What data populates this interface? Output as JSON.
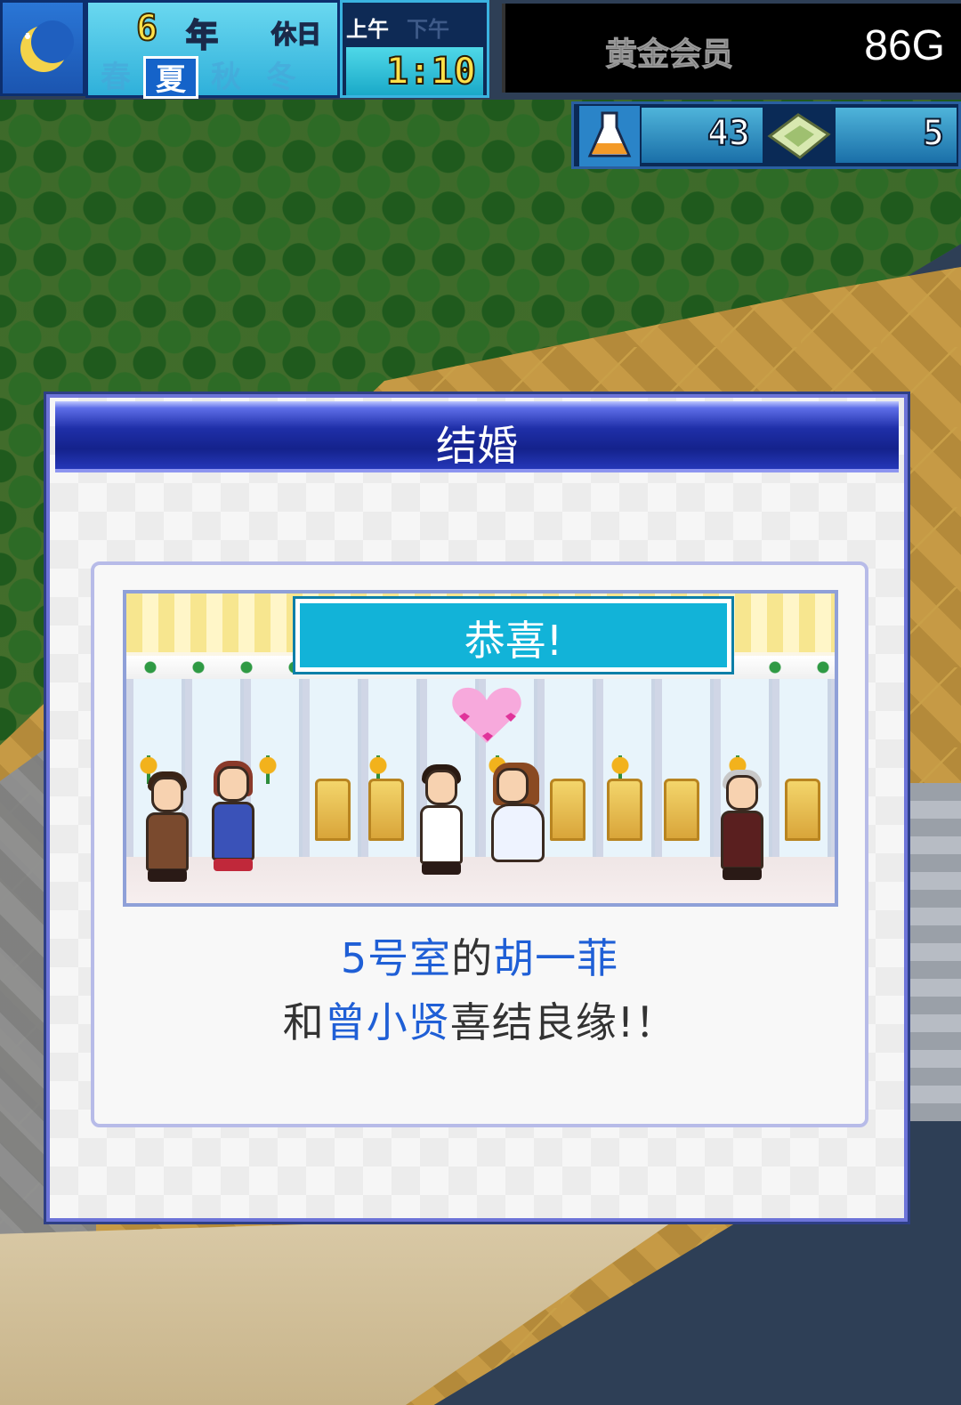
{
  "hud": {
    "year_number": "6",
    "year_unit": "年",
    "holiday": "休日",
    "seasons": [
      "春",
      "夏",
      "秋",
      "冬"
    ],
    "active_season": "夏",
    "am_label": "上午",
    "pm_label": "下午",
    "time": "1:10",
    "gold_label": "黄金会员",
    "money": "86G",
    "research_points": "43",
    "tickets": "5",
    "icons": {
      "moon": "moon-icon",
      "flask": "flask-icon",
      "ticket": "ticket-icon"
    }
  },
  "dialog": {
    "title": "结婚",
    "banner": "恭喜!",
    "line1": {
      "room": "5号室",
      "of": "的",
      "name1": "胡一菲"
    },
    "line2": {
      "and": "和",
      "name2": "曾小贤",
      "suffix": "喜结良缘!！"
    }
  },
  "colors": {
    "highlight": "#1f5fd6",
    "header_blue": "#14228c",
    "banner_cyan": "#12b3d8",
    "money_text": "#ffffff"
  }
}
